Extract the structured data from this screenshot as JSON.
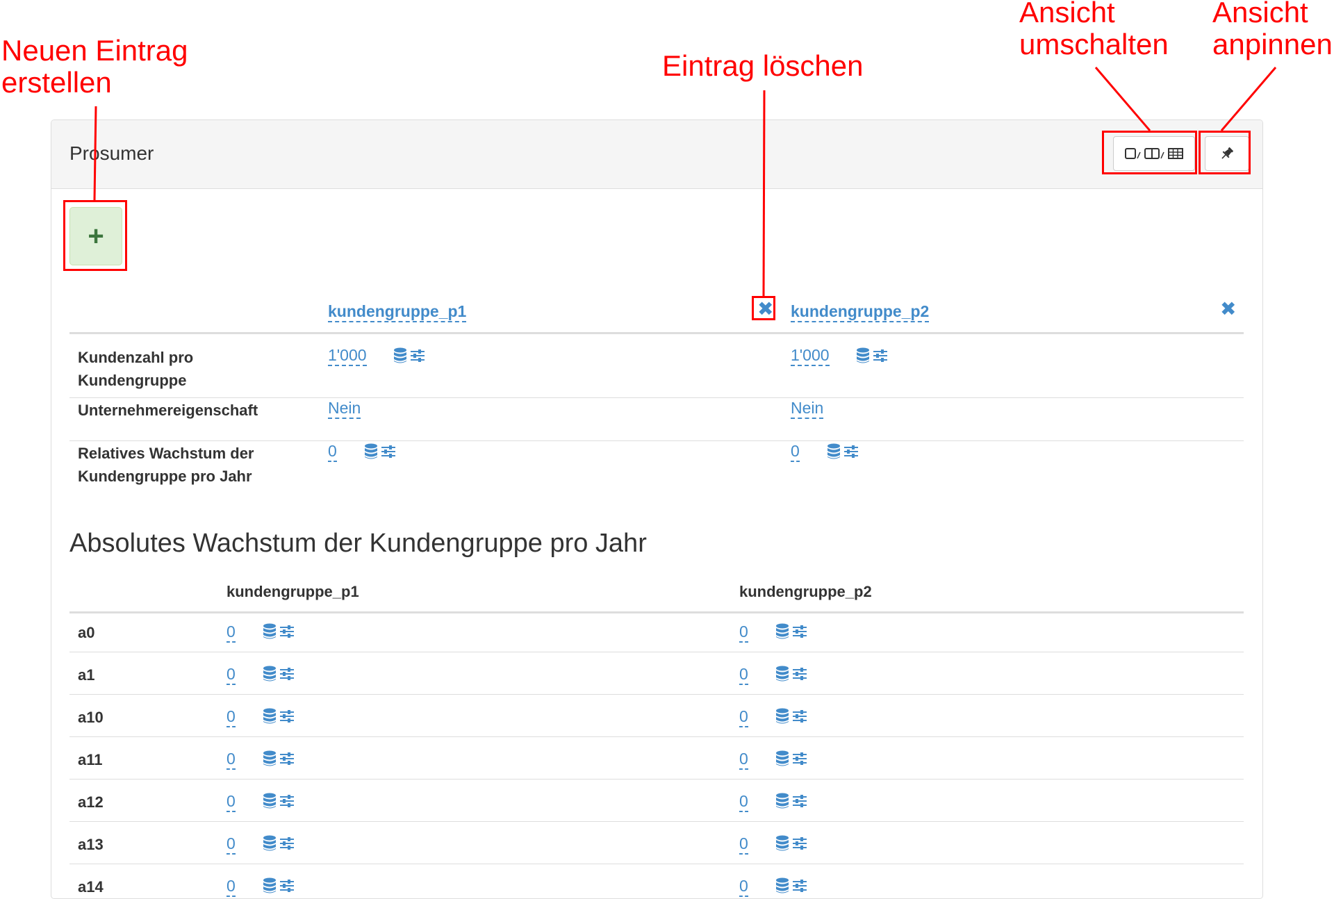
{
  "annotations": {
    "new_entry": "Neuen Eintrag\nerstellen",
    "delete_entry": "Eintrag löschen",
    "toggle_view": "Ansicht\numschalten",
    "pin_view": "Ansicht\nanpinnen"
  },
  "panel": {
    "title": "Prosumer",
    "add_label": "+",
    "delete_label": "✖"
  },
  "columns": [
    "kundengruppe_p1",
    "kundengruppe_p2"
  ],
  "rows": [
    {
      "label": "Kundenzahl pro\nKundengruppe",
      "values": [
        "1'000",
        "1'000"
      ],
      "has_icons": true
    },
    {
      "label": "Unternehmereigenschaft",
      "values": [
        "Nein",
        "Nein"
      ],
      "has_icons": false
    },
    {
      "label": "Relatives Wachstum der\nKundengruppe pro Jahr",
      "values": [
        "0",
        "0"
      ],
      "has_icons": true
    }
  ],
  "section": {
    "title": "Absolutes Wachstum der Kundengruppe pro Jahr",
    "columns": [
      "kundengruppe_p1",
      "kundengruppe_p2"
    ],
    "rows": [
      {
        "label": "a0",
        "values": [
          "0",
          "0"
        ]
      },
      {
        "label": "a1",
        "values": [
          "0",
          "0"
        ]
      },
      {
        "label": "a10",
        "values": [
          "0",
          "0"
        ]
      },
      {
        "label": "a11",
        "values": [
          "0",
          "0"
        ]
      },
      {
        "label": "a12",
        "values": [
          "0",
          "0"
        ]
      },
      {
        "label": "a13",
        "values": [
          "0",
          "0"
        ]
      },
      {
        "label": "a14",
        "values": [
          "0",
          "0"
        ]
      }
    ]
  },
  "icons": {
    "database": "database-icon",
    "sliders": "sliders-icon",
    "pin": "pin-icon",
    "view_single": "single-view-icon",
    "view_split": "split-view-icon",
    "view_table": "table-view-icon"
  },
  "colors": {
    "annotation": "#ff0000",
    "link": "#428bca",
    "add_bg": "#dff0d8",
    "add_fg": "#3c763d"
  }
}
